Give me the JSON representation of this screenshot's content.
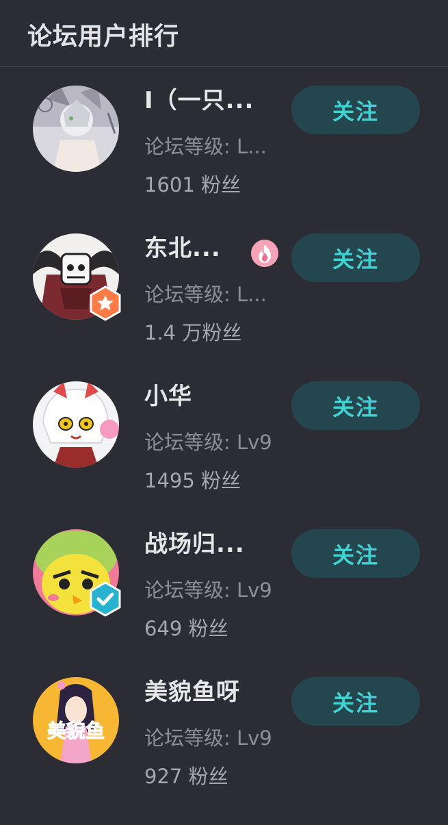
{
  "header": {
    "title": "论坛用户排行"
  },
  "users": [
    {
      "name": "I（一只...",
      "level": "论坛等级: L...",
      "fans": "1601 粉丝",
      "follow_label": "关注"
    },
    {
      "name": "东北...",
      "level": "论坛等级: L...",
      "fans": "1.4 万粉丝",
      "follow_label": "关注"
    },
    {
      "name": "小华",
      "level": "论坛等级: Lv9",
      "fans": "1495 粉丝",
      "follow_label": "关注"
    },
    {
      "name": "战场归...",
      "level": "论坛等级: Lv9",
      "fans": "649 粉丝",
      "follow_label": "关注"
    },
    {
      "name": "美貌鱼呀",
      "level": "论坛等级: Lv9",
      "fans": "927 粉丝",
      "follow_label": "关注",
      "avatar_text": "美貌鱼"
    }
  ],
  "colors": {
    "background": "#2c2d34",
    "follow_bg": "#24464e",
    "follow_text": "#41d3d3",
    "badge_orange": "#ff7a45",
    "badge_teal": "#27b3d0",
    "flame_pink": "#f6a3b8"
  },
  "icons": [
    "star-badge-icon",
    "verified-badge-icon",
    "flame-icon"
  ]
}
